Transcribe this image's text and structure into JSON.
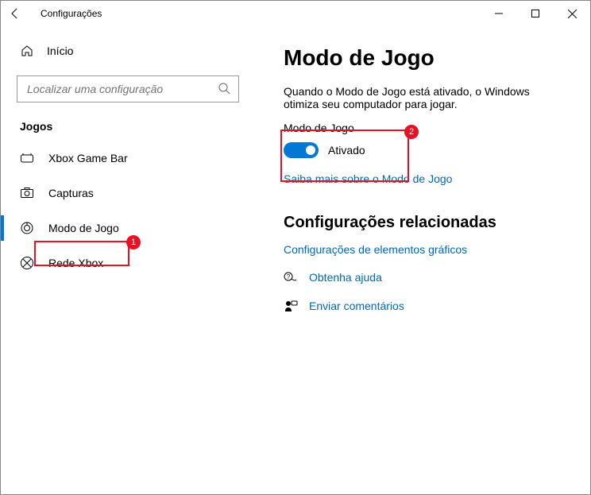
{
  "titlebar": {
    "title": "Configurações"
  },
  "sidebar": {
    "home": "Início",
    "search_placeholder": "Localizar uma configuração",
    "section": "Jogos",
    "items": [
      {
        "label": "Xbox Game Bar"
      },
      {
        "label": "Capturas"
      },
      {
        "label": "Modo de Jogo"
      },
      {
        "label": "Rede Xbox"
      }
    ]
  },
  "main": {
    "heading": "Modo de Jogo",
    "description": "Quando o Modo de Jogo está ativado, o Windows otimiza seu computador para jogar.",
    "toggle_label": "Modo de Jogo",
    "toggle_state": "Ativado",
    "learn_more": "Saiba mais sobre o Modo de Jogo",
    "related_heading": "Configurações relacionadas",
    "related_link": "Configurações de elementos gráficos",
    "help": "Obtenha ajuda",
    "feedback": "Enviar comentários"
  },
  "annotations": {
    "a1": "1",
    "a2": "2"
  }
}
